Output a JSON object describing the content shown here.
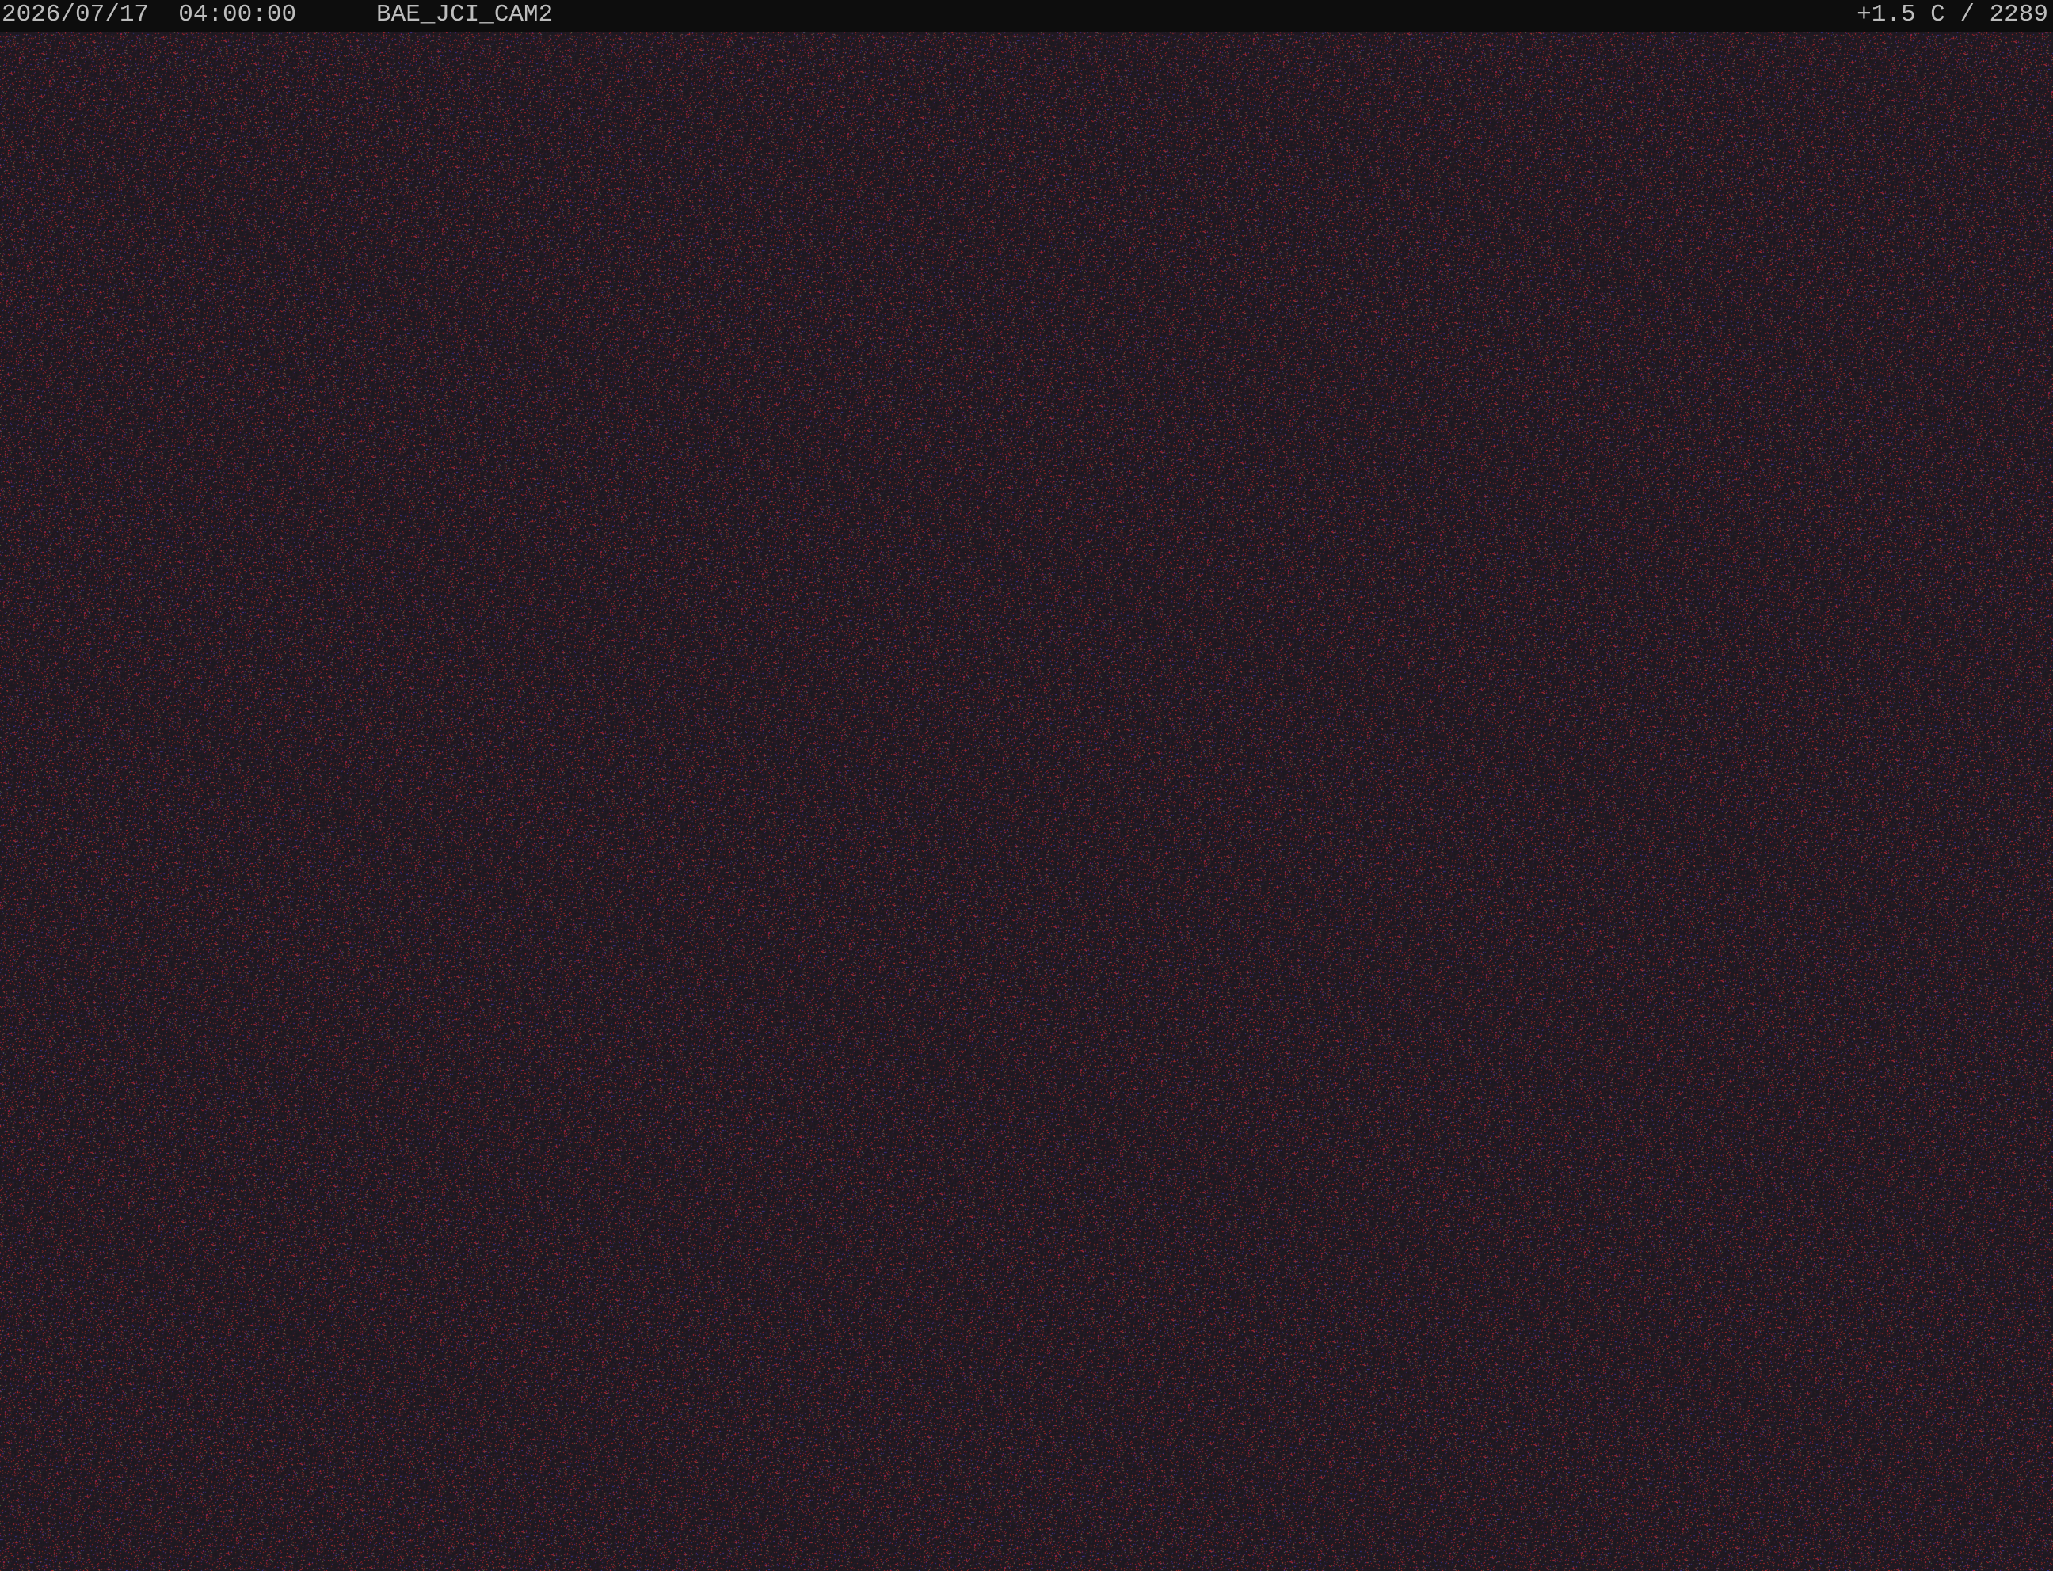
{
  "overlay": {
    "date": "2026/07/17",
    "time": "04:00:00",
    "camera_id": "BAE_JCI_CAM2",
    "temperature": "+1.5 C",
    "altitude": "2289"
  },
  "colors": {
    "overlay_bar": "#0d0d0d",
    "overlay_text": "#bdbdbd",
    "scene_base": "#1c181d",
    "noise_red": "#b8302a",
    "noise_blue": "#4a3a9a"
  }
}
